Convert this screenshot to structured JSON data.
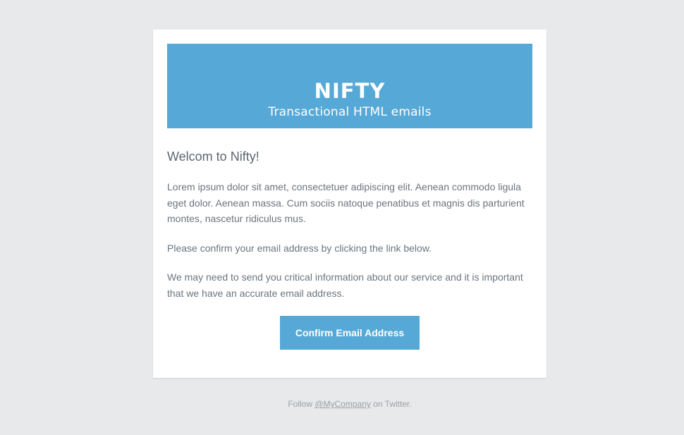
{
  "header": {
    "brand": "NIFTY",
    "tagline": "Transactional HTML emails"
  },
  "content": {
    "heading": "Welcom to Nifty!",
    "paragraphs": [
      "Lorem ipsum dolor sit amet, consectetuer adipiscing elit. Aenean commodo ligula eget dolor. Aenean massa. Cum sociis natoque penatibus et magnis dis parturient montes, nascetur ridiculus mus.",
      "Please confirm your email address by clicking the link below.",
      "We may need to send you critical information about our service and it is important that we have an accurate email address."
    ],
    "cta_label": "Confirm Email Address"
  },
  "footer": {
    "prefix": "Follow ",
    "link_text": "@MyCompany",
    "suffix": " on Twitter."
  },
  "colors": {
    "accent": "#56a9d6",
    "background": "#e8e9ea",
    "card": "#ffffff",
    "text": "#6a7580"
  }
}
